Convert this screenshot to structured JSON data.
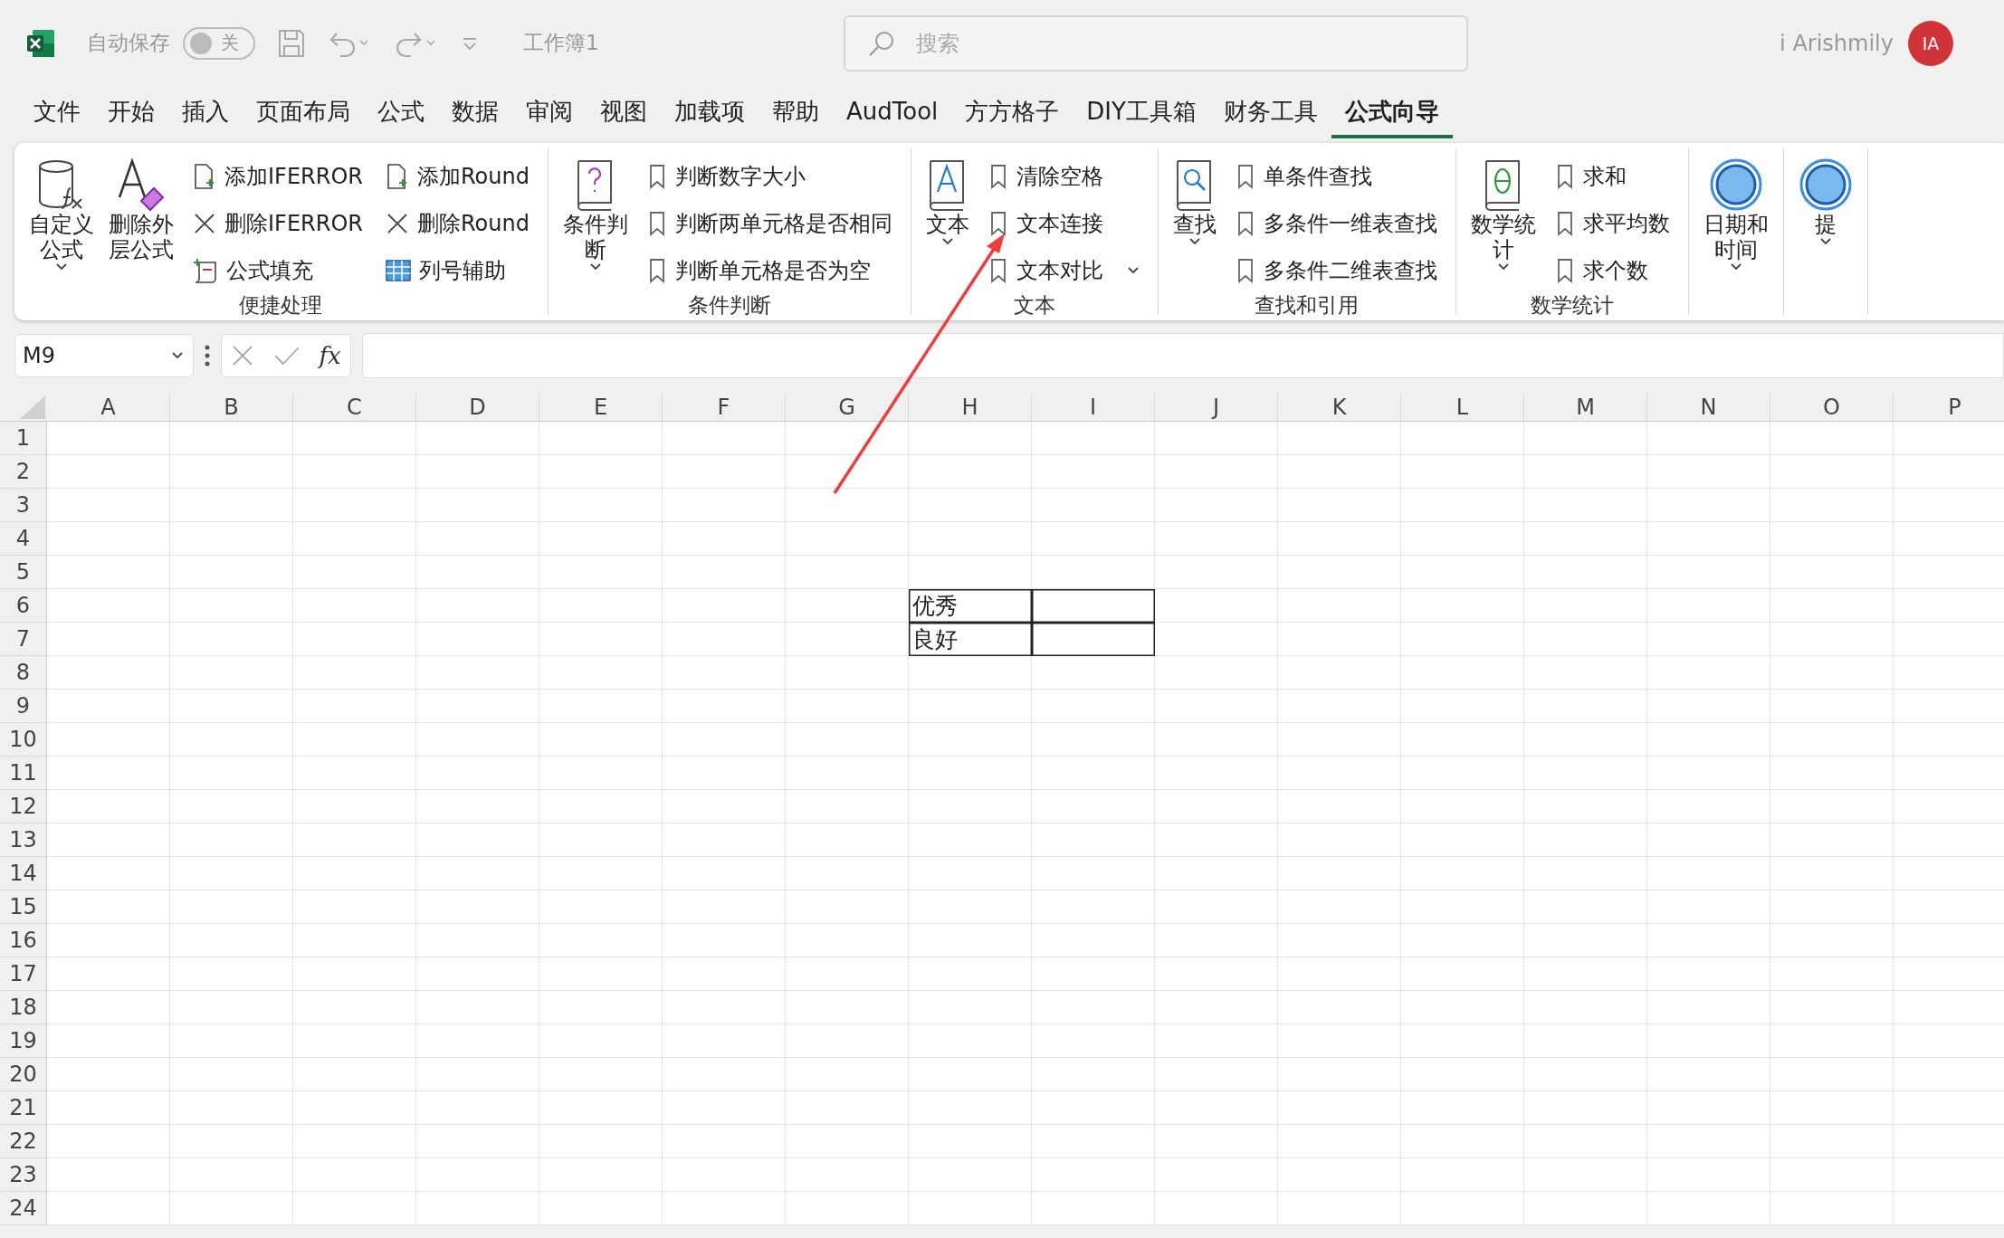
{
  "title_bar": {
    "autosave_label": "自动保存",
    "autosave": {
      "on": false,
      "label": "关"
    },
    "workbook": "工作簿1",
    "search": {
      "placeholder": "搜索"
    },
    "user_name": "i Arishmily",
    "avatar": "IA"
  },
  "tabs": [
    {
      "label": "文件",
      "selected": false
    },
    {
      "label": "开始",
      "selected": false
    },
    {
      "label": "插入",
      "selected": false
    },
    {
      "label": "页面布局",
      "selected": false
    },
    {
      "label": "公式",
      "selected": false
    },
    {
      "label": "数据",
      "selected": false
    },
    {
      "label": "审阅",
      "selected": false
    },
    {
      "label": "视图",
      "selected": false
    },
    {
      "label": "加载项",
      "selected": false
    },
    {
      "label": "帮助",
      "selected": false
    },
    {
      "label": "AudTool",
      "selected": false
    },
    {
      "label": "方方格子",
      "selected": false
    },
    {
      "label": "DIY工具箱",
      "selected": false
    },
    {
      "label": "财务工具",
      "selected": false
    },
    {
      "label": "公式向导",
      "selected": true
    }
  ],
  "ribbon": {
    "groups": [
      {
        "label": "便捷处理",
        "items": [
          {
            "kind": "large",
            "lines": [
              "自定义",
              "公式"
            ],
            "dropdown": true
          },
          {
            "kind": "large",
            "lines": [
              "删除外",
              "层公式"
            ],
            "dropdown": false
          },
          {
            "kind": "small",
            "label": "添加IFERROR",
            "dropdown": false
          },
          {
            "kind": "small",
            "label": "删除IFERROR",
            "dropdown": false
          },
          {
            "kind": "small",
            "label": "公式填充",
            "dropdown": false
          },
          {
            "kind": "small",
            "label": "添加Round",
            "dropdown": false
          },
          {
            "kind": "small",
            "label": "删除Round",
            "dropdown": false
          },
          {
            "kind": "small",
            "label": "列号辅助",
            "dropdown": false
          }
        ]
      },
      {
        "label": "条件判断",
        "items": [
          {
            "kind": "large",
            "lines": [
              "条件判",
              "断"
            ],
            "dropdown": true
          },
          {
            "kind": "small",
            "label": "判断数字大小",
            "dropdown": false
          },
          {
            "kind": "small",
            "label": "判断两单元格是否相同",
            "dropdown": false
          },
          {
            "kind": "small",
            "label": "判断单元格是否为空",
            "dropdown": false
          }
        ]
      },
      {
        "label": "文本",
        "items": [
          {
            "kind": "large",
            "lines": [
              "文本"
            ],
            "dropdown": true
          },
          {
            "kind": "small",
            "label": "清除空格",
            "dropdown": false
          },
          {
            "kind": "small",
            "label": "文本连接",
            "dropdown": false
          },
          {
            "kind": "small",
            "label": "文本对比",
            "dropdown": true
          }
        ]
      },
      {
        "label": "查找和引用",
        "items": [
          {
            "kind": "large",
            "lines": [
              "查找"
            ],
            "dropdown": true
          },
          {
            "kind": "small",
            "label": "单条件查找",
            "dropdown": false
          },
          {
            "kind": "small",
            "label": "多条件一维表查找",
            "dropdown": false
          },
          {
            "kind": "small",
            "label": "多条件二维表查找",
            "dropdown": false
          }
        ]
      },
      {
        "label": "数学统计",
        "items": [
          {
            "kind": "large",
            "lines": [
              "数学统",
              "计"
            ],
            "dropdown": true
          },
          {
            "kind": "small",
            "label": "求和",
            "dropdown": false
          },
          {
            "kind": "small",
            "label": "求平均数",
            "dropdown": false
          },
          {
            "kind": "small",
            "label": "求个数",
            "dropdown": false
          }
        ]
      },
      {
        "items": [
          {
            "kind": "large",
            "lines": [
              "日期和",
              "时间"
            ],
            "dropdown": true
          }
        ]
      },
      {
        "items": [
          {
            "kind": "large",
            "lines": [
              "提"
            ],
            "dropdown": true
          }
        ]
      }
    ]
  },
  "formula_bar": {
    "name_box": "M9",
    "function_button": "fx"
  },
  "sheet": {
    "columns": [
      "A",
      "B",
      "C",
      "D",
      "E",
      "F",
      "G",
      "H",
      "I",
      "J",
      "K",
      "L",
      "M",
      "N",
      "O",
      "P"
    ],
    "rows": [
      "1",
      "2",
      "3",
      "4",
      "5",
      "6",
      "7",
      "8",
      "9",
      "10",
      "11",
      "12",
      "13",
      "14",
      "15",
      "16",
      "17",
      "18",
      "19",
      "20",
      "21",
      "22",
      "23",
      "24"
    ],
    "table": {
      "rows": [
        {
          "cells": [
            {
              "text": "优秀",
              "bordered": true
            },
            {
              "bordered": true
            }
          ]
        },
        {
          "cells": [
            {
              "text": "良好",
              "bordered": true
            },
            {
              "bordered": true
            }
          ]
        }
      ]
    }
  }
}
